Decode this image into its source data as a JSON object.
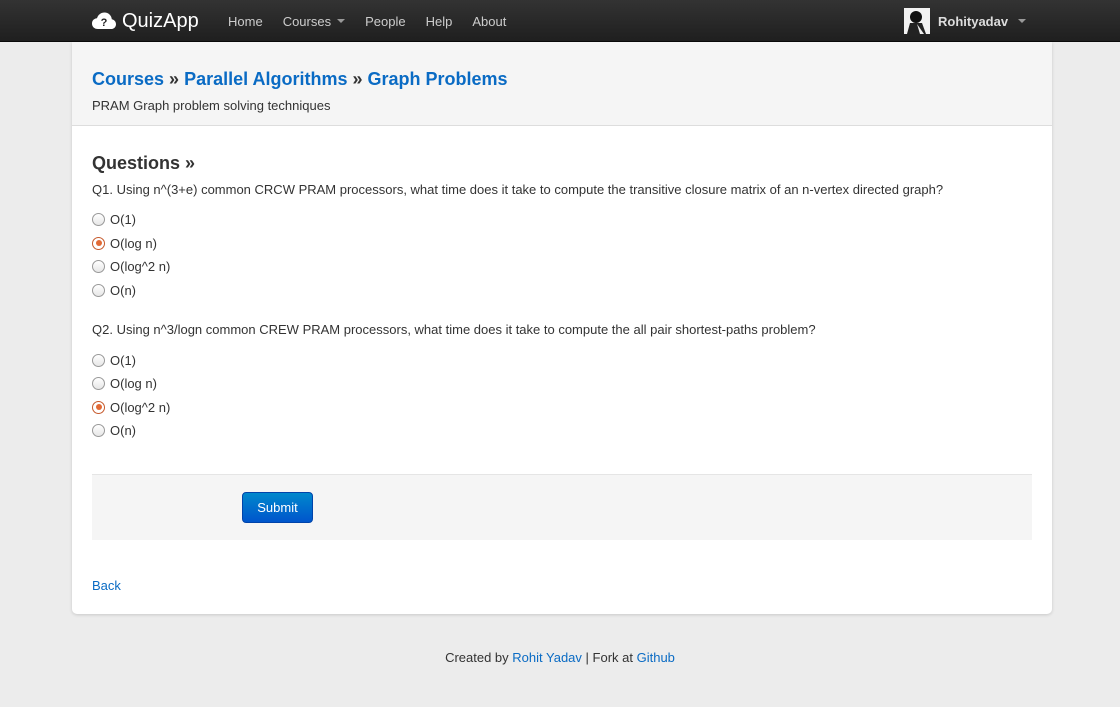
{
  "navbar": {
    "brand": "QuizApp",
    "items": [
      {
        "label": "Home"
      },
      {
        "label": "Courses",
        "dropdown": true
      },
      {
        "label": "People"
      },
      {
        "label": "Help"
      },
      {
        "label": "About"
      }
    ],
    "user": "Rohityadav"
  },
  "header": {
    "crumbs": [
      "Courses",
      "Parallel Algorithms",
      "Graph Problems"
    ],
    "separator": "»",
    "subtitle": "PRAM Graph problem solving techniques"
  },
  "questions_heading": "Questions »",
  "questions": [
    {
      "text": "Q1. Using n^(3+e) common CRCW PRAM processors, what time does it take to compute the transitive closure matrix of an n-vertex directed graph?",
      "options": [
        "O(1)",
        "O(log n)",
        "O(log^2 n)",
        "O(n)"
      ],
      "selected": 1
    },
    {
      "text": "Q2. Using n^3/logn common CREW PRAM processors, what time does it take to compute the all pair shortest-paths problem?",
      "options": [
        "O(1)",
        "O(log n)",
        "O(log^2 n)",
        "O(n)"
      ],
      "selected": 2
    }
  ],
  "submit_label": "Submit",
  "back_label": "Back",
  "footer": {
    "created_by": "Created by",
    "author": "Rohit Yadav",
    "fork_text": "| Fork at",
    "github": "Github"
  },
  "colors": {
    "navbar": "#222222",
    "link": "#0a6bc4",
    "button": "#0074cc",
    "radio_selected": "#e26a35"
  },
  "icons": {
    "brand": "cloud-question-icon",
    "dropdown": "caret-down-icon",
    "user": "avatar"
  }
}
